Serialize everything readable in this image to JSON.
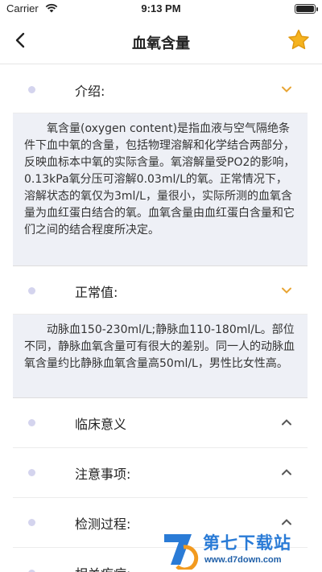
{
  "status_bar": {
    "carrier": "Carrier",
    "time": "9:13 PM",
    "battery_level": 1.0
  },
  "nav": {
    "title": "血氧含量",
    "back_icon": "chevron-left-icon",
    "favorite_icon": "star-icon"
  },
  "sections": [
    {
      "label": "介绍:",
      "expanded": true,
      "body": "氧含量(oxygen content)是指血液与空气隔绝条件下血中氧的含量，包括物理溶解和化学结合两部分，反映血标本中氧的实际含量。氧溶解量受PO2的影响，0.13kPa氧分压可溶解0.03ml/L的氧。正常情况下，溶解状态的氧仅为3ml/L，量很小，实际所测的血氧含量为血红蛋白结合的氧。血氧含量由血红蛋白含量和它们之间的结合程度所决定。"
    },
    {
      "label": "正常值:",
      "expanded": true,
      "body": "动脉血150-230ml/L;静脉血110-180ml/L。部位不同，静脉血氧含量可有很大的差别。同一人的动脉血氧含量约比静脉血氧含量高50ml/L，男性比女性高。"
    },
    {
      "label": "临床意义",
      "expanded": false
    },
    {
      "label": "注意事项:",
      "expanded": false
    },
    {
      "label": "检测过程:",
      "expanded": false
    },
    {
      "label": "相关疾病:",
      "expanded": false
    }
  ],
  "watermark": {
    "title": "第七下载站",
    "url": "www.d7down.com"
  },
  "colors": {
    "accent_chevron": "#e8a534",
    "star": "#f5b31f",
    "dot": "#d4d4ee",
    "body_bg": "#eef0f6"
  }
}
